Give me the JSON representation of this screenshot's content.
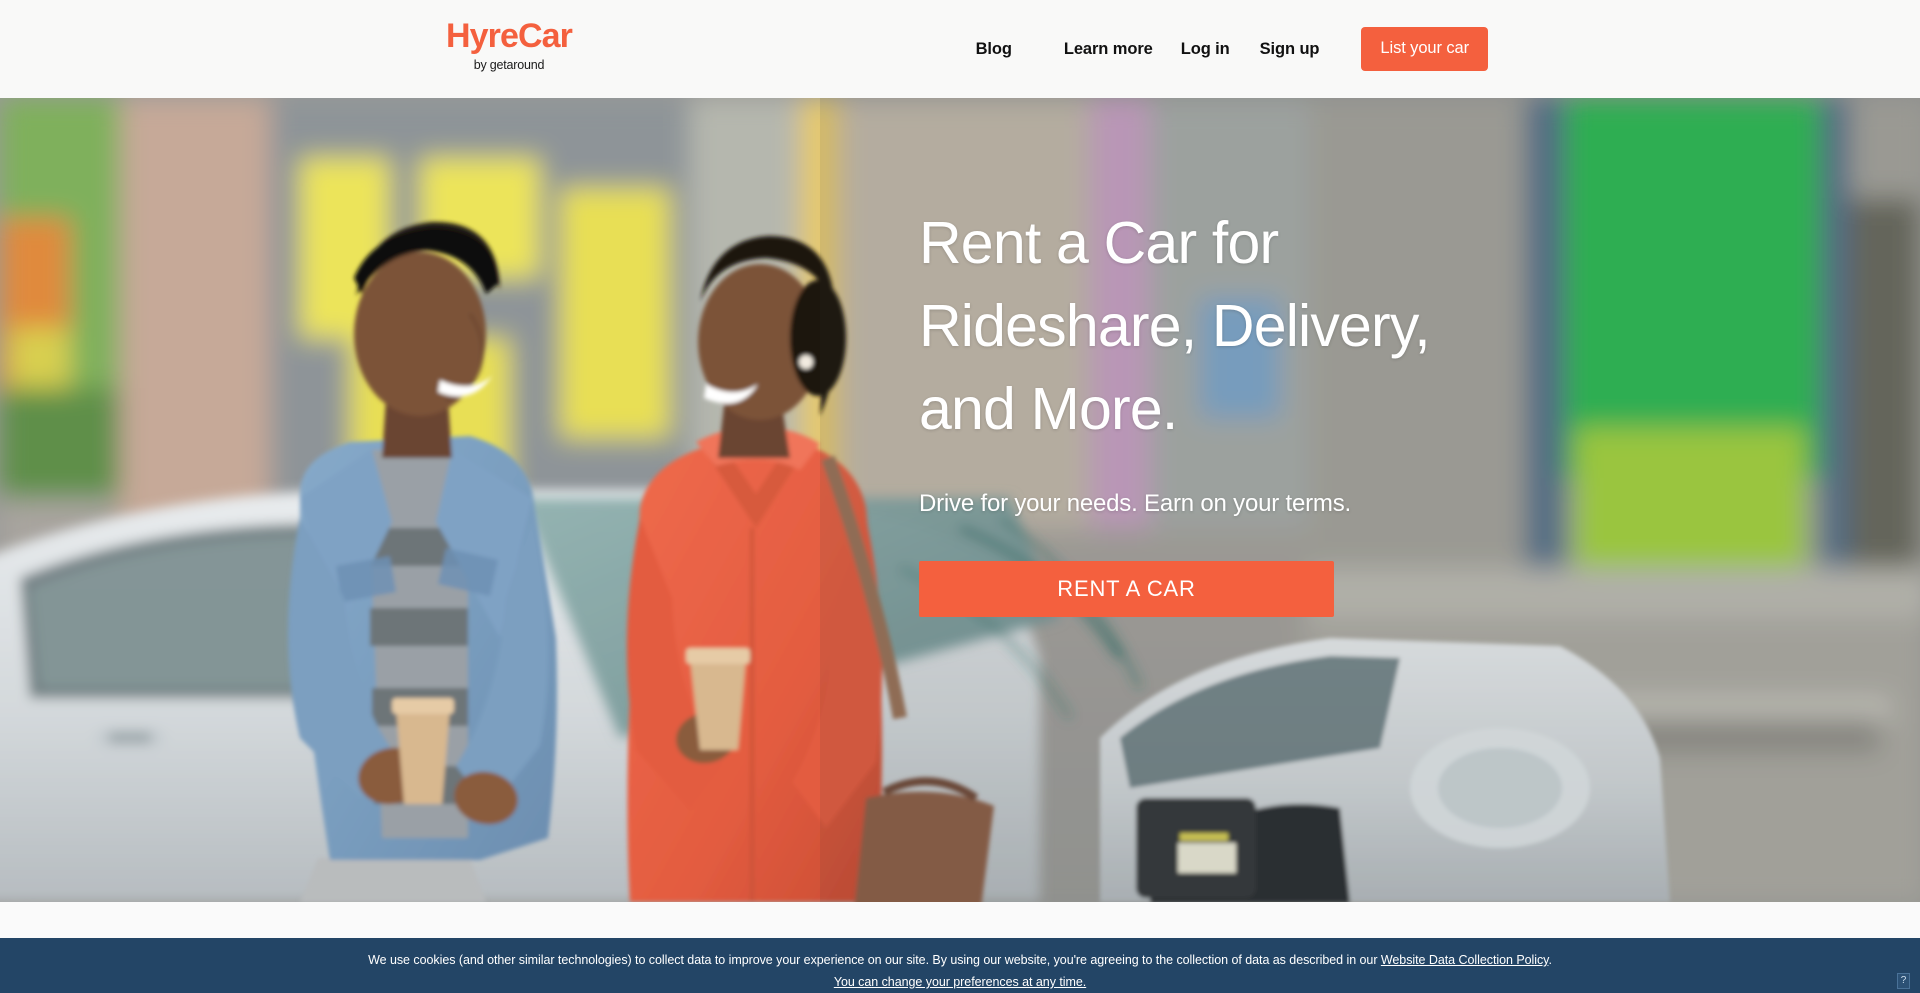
{
  "header": {
    "logo": {
      "main": "HyreCar",
      "sub": "by getaround"
    },
    "nav": [
      {
        "label": "Blog"
      },
      {
        "label": "Learn more"
      },
      {
        "label": "Log in"
      },
      {
        "label": "Sign up"
      }
    ],
    "list_car_button": "List your car"
  },
  "hero": {
    "title_line_1": "Rent a Car for",
    "title_line_2": "Rideshare, Delivery,",
    "title_line_3": "and More.",
    "subtitle": "Drive for your needs. Earn on your terms.",
    "cta_label": "RENT A CAR",
    "photo_alt": "Smiling man in denim jacket and woman in coral coat holding coffee cups beside a white electric car on a city street"
  },
  "cookie_banner": {
    "line1_before_link": "We use cookies (and other similar technologies) to collect data to improve your experience on our site. By using our website, you're agreeing to the collection of data as described in our ",
    "line1_link": "Website Data Collection Policy",
    "line1_after_link": ".",
    "line2_link": "You can change your preferences at any time.",
    "help_icon_label": "?"
  },
  "colors": {
    "brand_coral": "#f4603e",
    "header_bg": "#f9f9f8",
    "banner_blue": "#234566",
    "nav_text": "#111111",
    "hero_text": "#ffffff"
  }
}
